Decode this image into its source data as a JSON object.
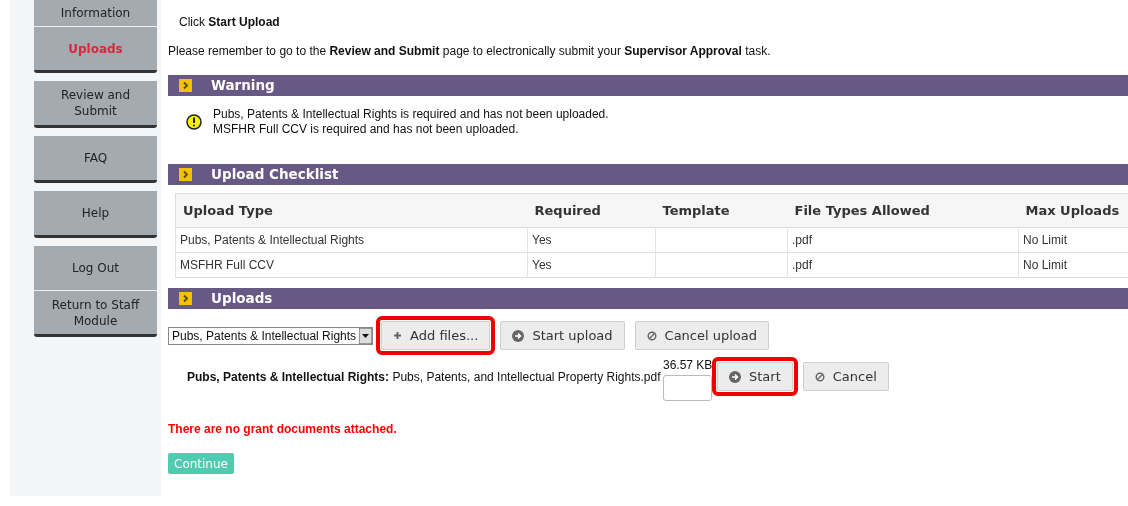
{
  "sidebar": {
    "groups": [
      {
        "items": [
          {
            "label": "Information",
            "selected": false
          },
          {
            "label": "Uploads",
            "selected": true
          }
        ]
      },
      {
        "items": [
          {
            "label": "Review and Submit",
            "selected": false
          }
        ]
      },
      {
        "items": [
          {
            "label": "FAQ",
            "selected": false
          }
        ]
      },
      {
        "items": [
          {
            "label": "Help",
            "selected": false
          }
        ]
      },
      {
        "items": [
          {
            "label": "Log Out",
            "selected": false
          },
          {
            "label": "Return to Staff Module",
            "selected": false
          }
        ]
      }
    ]
  },
  "instructions": [
    "Click **Start Upload**",
    "Please remember to go to the **Review and Submit** page to electronically submit your **Supervisor Approval** task."
  ],
  "warning": {
    "title": "Warning",
    "messages": [
      "Pubs, Patents & Intellectual Rights is required and has not been uploaded.",
      "MSFHR Full CCV is required and has not been uploaded."
    ]
  },
  "checklist": {
    "title": "Upload Checklist",
    "columns": [
      "Upload Type",
      "Required",
      "Template",
      "File Types Allowed",
      "Max Uploads"
    ],
    "rows": [
      [
        "Pubs, Patents & Intellectual Rights",
        "Yes",
        "",
        ".pdf",
        "No Limit"
      ],
      [
        "MSFHR Full CCV",
        "Yes",
        "",
        ".pdf",
        "No Limit"
      ]
    ]
  },
  "uploads": {
    "title": "Uploads",
    "type_select": "Pubs, Patents & Intellectual Rights",
    "buttons": [
      {
        "kind": "add",
        "label": "Add files...",
        "highlighted": true
      },
      {
        "kind": "start",
        "label": "Start upload",
        "highlighted": false
      },
      {
        "kind": "cancel",
        "label": "Cancel upload",
        "highlighted": false
      }
    ],
    "file": {
      "type_label": "Pubs, Patents & Intellectual Rights:",
      "name": "Pubs, Patents, and Intellectual Property Rights.pdf",
      "size": "36.57 KB",
      "buttons": [
        {
          "kind": "start",
          "label": "Start",
          "highlighted": true
        },
        {
          "kind": "cancel",
          "label": "Cancel",
          "highlighted": false
        }
      ]
    },
    "error": "There are no grant documents attached.",
    "continue": "Continue"
  }
}
